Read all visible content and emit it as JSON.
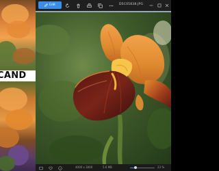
{
  "background": {
    "banner_text": "CAND"
  },
  "toolbar": {
    "edit_label": "Edit",
    "file_title": "DSC05838.JPG",
    "icons": [
      "edit-icon",
      "rotate-icon",
      "delete-icon",
      "print-icon",
      "copy-icon",
      "share-icon",
      "more-icon",
      "minimize-icon",
      "maximize-icon",
      "close-icon"
    ],
    "accent_color": "#3a8ee6"
  },
  "status_bar": {
    "file_info": "4000 x 3000",
    "file_size": "5.6 MB",
    "zoom_text": "23 %",
    "zoom_level": 0.23
  },
  "image": {
    "subject": "orange and burgundy bearded iris flower"
  }
}
